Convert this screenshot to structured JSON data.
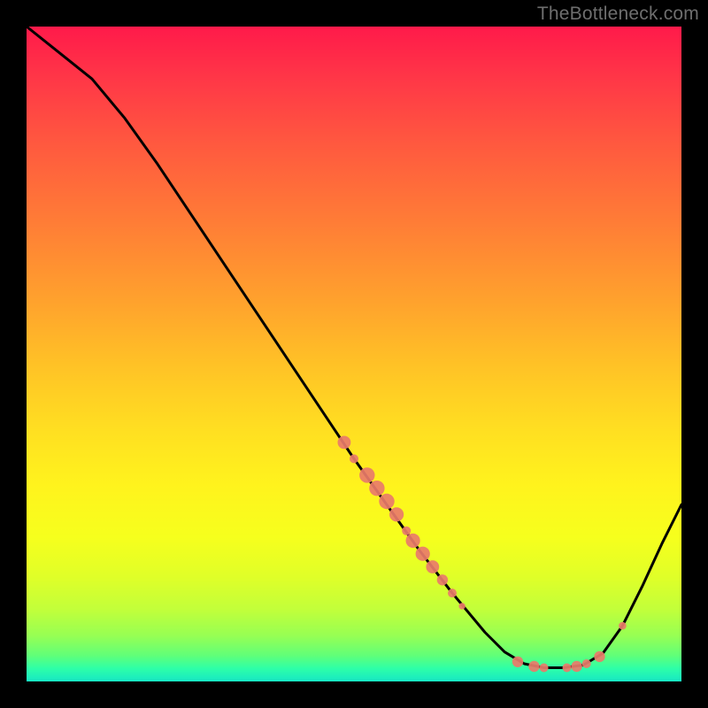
{
  "watermark": "TheBottleneck.com",
  "chart_data": {
    "type": "line",
    "title": "",
    "xlabel": "",
    "ylabel": "",
    "xlim": [
      0,
      100
    ],
    "ylim": [
      0,
      100
    ],
    "curve": [
      {
        "x": 0,
        "y": 100
      },
      {
        "x": 5,
        "y": 96
      },
      {
        "x": 10,
        "y": 92
      },
      {
        "x": 15,
        "y": 86
      },
      {
        "x": 20,
        "y": 79
      },
      {
        "x": 25,
        "y": 71.5
      },
      {
        "x": 30,
        "y": 64
      },
      {
        "x": 35,
        "y": 56.5
      },
      {
        "x": 40,
        "y": 49
      },
      {
        "x": 45,
        "y": 41.5
      },
      {
        "x": 50,
        "y": 34
      },
      {
        "x": 55,
        "y": 27
      },
      {
        "x": 60,
        "y": 20
      },
      {
        "x": 65,
        "y": 13.5
      },
      {
        "x": 70,
        "y": 7.5
      },
      {
        "x": 73,
        "y": 4.5
      },
      {
        "x": 76,
        "y": 2.7
      },
      {
        "x": 79,
        "y": 2.1
      },
      {
        "x": 82,
        "y": 2.1
      },
      {
        "x": 85,
        "y": 2.5
      },
      {
        "x": 88,
        "y": 4.3
      },
      {
        "x": 91,
        "y": 8.5
      },
      {
        "x": 94,
        "y": 14.5
      },
      {
        "x": 97,
        "y": 21
      },
      {
        "x": 100,
        "y": 27
      }
    ],
    "points": [
      {
        "x": 48.5,
        "y": 36.5,
        "r": 1.2
      },
      {
        "x": 50,
        "y": 34.0,
        "r": 0.8
      },
      {
        "x": 52,
        "y": 31.5,
        "r": 1.4
      },
      {
        "x": 53.5,
        "y": 29.5,
        "r": 1.4
      },
      {
        "x": 55,
        "y": 27.5,
        "r": 1.4
      },
      {
        "x": 56.5,
        "y": 25.5,
        "r": 1.3
      },
      {
        "x": 58,
        "y": 23.0,
        "r": 0.8
      },
      {
        "x": 59,
        "y": 21.5,
        "r": 1.3
      },
      {
        "x": 60.5,
        "y": 19.5,
        "r": 1.3
      },
      {
        "x": 62,
        "y": 17.5,
        "r": 1.2
      },
      {
        "x": 63.5,
        "y": 15.5,
        "r": 1.0
      },
      {
        "x": 65,
        "y": 13.5,
        "r": 0.8
      },
      {
        "x": 66.5,
        "y": 11.5,
        "r": 0.6
      },
      {
        "x": 75,
        "y": 3.0,
        "r": 1.0
      },
      {
        "x": 77.5,
        "y": 2.3,
        "r": 1.0
      },
      {
        "x": 79,
        "y": 2.1,
        "r": 0.8
      },
      {
        "x": 82.5,
        "y": 2.1,
        "r": 0.8
      },
      {
        "x": 84,
        "y": 2.3,
        "r": 1.0
      },
      {
        "x": 85.5,
        "y": 2.7,
        "r": 0.8
      },
      {
        "x": 87.5,
        "y": 3.8,
        "r": 1.0
      },
      {
        "x": 91,
        "y": 8.5,
        "r": 0.7
      }
    ],
    "colors": {
      "curve": "#000000",
      "points": "#e97b6a"
    }
  }
}
